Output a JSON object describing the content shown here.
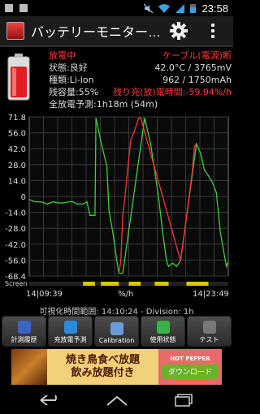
{
  "status_bar": {
    "time": "23:58"
  },
  "app": {
    "title": "バッテリーモニター…"
  },
  "info": {
    "state": "放電中",
    "source": "ケーブル(電源)断",
    "health_label": "状態:良好",
    "temp_voltage": "42.0°C / 3765mV",
    "type_label": "種類:Li-ion",
    "capacity": "962 / 1750mAh",
    "remaining_label": "残容量:55%",
    "remaining_time": "残り充(放)電時間:-59.94%/h",
    "full_discharge": "全放電予測:1h18m (54m)"
  },
  "chart_data": {
    "type": "line",
    "y_ticks": [
      "71.8",
      "56.0",
      "42.0",
      "28.0",
      "14.0",
      "0",
      "-14.0",
      "-28.0",
      "-42.0",
      "-56.0",
      "-68.4"
    ],
    "ylim": [
      -68.4,
      71.8
    ],
    "screen_label": "Screen",
    "x_left": "14|09:39",
    "x_mid": "%/h",
    "x_right": "14|23:49",
    "series": [
      {
        "color": "#3ecf3e",
        "points": [
          [
            0,
            -1
          ],
          [
            0.03,
            -3
          ],
          [
            0.06,
            -3
          ],
          [
            0.09,
            -5
          ],
          [
            0.12,
            -3
          ],
          [
            0.15,
            -4
          ],
          [
            0.17,
            -4
          ],
          [
            0.2,
            -3
          ],
          [
            0.22,
            -3
          ],
          [
            0.24,
            -5
          ],
          [
            0.27,
            -5
          ],
          [
            0.29,
            -3
          ],
          [
            0.305,
            -15
          ],
          [
            0.33,
            -15
          ],
          [
            0.335,
            71
          ],
          [
            0.36,
            50
          ],
          [
            0.39,
            28
          ],
          [
            0.4,
            -10
          ],
          [
            0.42,
            -30
          ],
          [
            0.44,
            -55
          ],
          [
            0.45,
            -66
          ],
          [
            0.46,
            -66
          ],
          [
            0.47,
            -66
          ],
          [
            0.58,
            71
          ],
          [
            0.61,
            48
          ],
          [
            0.63,
            25
          ],
          [
            0.65,
            0
          ],
          [
            0.67,
            -30
          ],
          [
            0.69,
            -55
          ],
          [
            0.7,
            -60
          ],
          [
            0.72,
            -57
          ],
          [
            0.74,
            -60
          ],
          [
            0.76,
            -55
          ],
          [
            0.84,
            48
          ],
          [
            0.86,
            40
          ],
          [
            0.88,
            25
          ],
          [
            0.9,
            20
          ],
          [
            0.92,
            14
          ],
          [
            0.94,
            5
          ],
          [
            0.96,
            -30
          ],
          [
            0.98,
            -50
          ],
          [
            0.99,
            -60
          ],
          [
            1.0,
            -56
          ]
        ]
      },
      {
        "color": "#ff3333",
        "points": [
          [
            0.45,
            -66
          ],
          [
            0.46,
            -55
          ],
          [
            0.47,
            -15
          ],
          [
            0.48,
            0
          ],
          [
            0.5,
            35
          ],
          [
            0.51,
            51
          ],
          [
            0.53,
            60
          ],
          [
            0.55,
            71
          ],
          [
            0.56,
            71
          ],
          [
            0.76,
            -55
          ],
          [
            0.78,
            -30
          ],
          [
            0.8,
            -3
          ],
          [
            0.82,
            25
          ],
          [
            0.83,
            46
          ],
          [
            0.84,
            48
          ]
        ]
      }
    ]
  },
  "visible_range": "可視化時間範囲: 14:10:24 - Division: 1h",
  "buttons": [
    {
      "label": "計測履歴",
      "color": "#3a63c8"
    },
    {
      "label": "充放電予測",
      "color": "#2d8ad8"
    },
    {
      "label": "Calibration",
      "color": "#6a9ad8"
    },
    {
      "label": "使用状態",
      "color": "#3ab24a"
    },
    {
      "label": "テスト",
      "color": "#777777"
    }
  ],
  "ad": {
    "line1": "焼き鳥食べ放題",
    "line2": "飲み放題付き",
    "logo": "HOT PEPPER",
    "download": "ダウンロード"
  }
}
